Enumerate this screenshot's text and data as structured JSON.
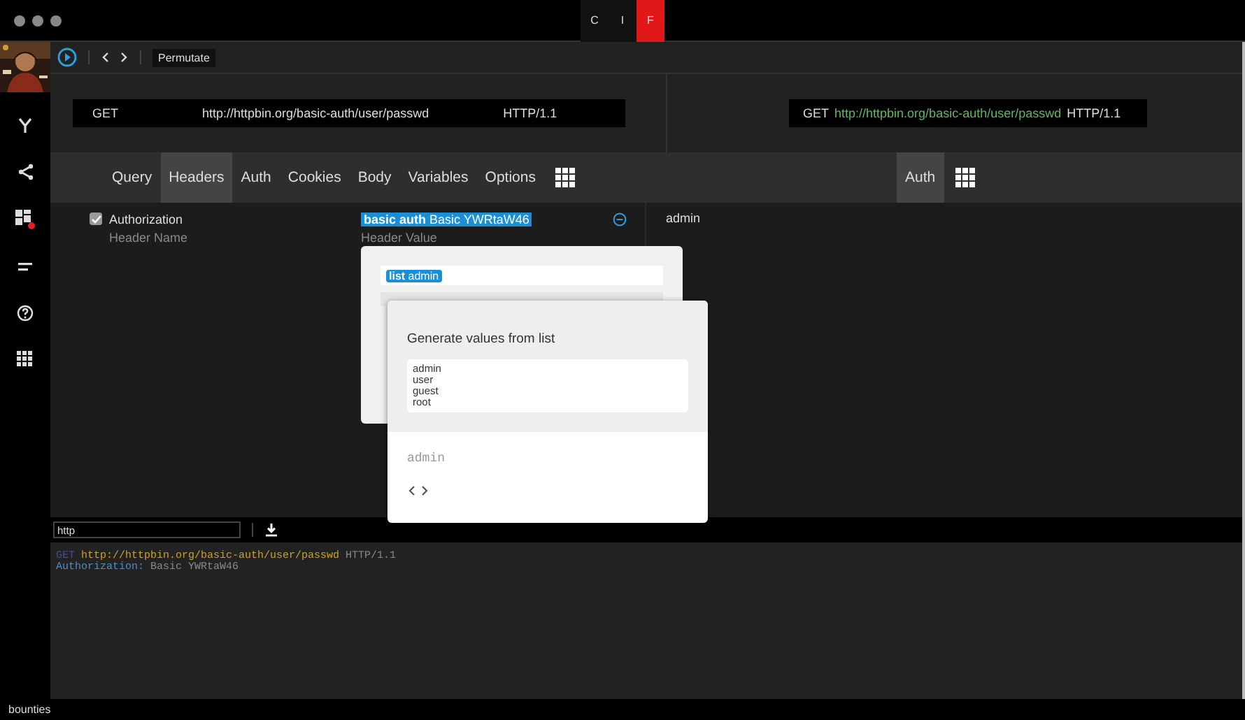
{
  "window": {
    "tabs": [
      {
        "label": "C",
        "selected": false
      },
      {
        "label": "I",
        "selected": false
      },
      {
        "label": "F",
        "selected": true
      }
    ]
  },
  "toolbar": {
    "mode_select": "Permutate"
  },
  "request": {
    "method": "GET",
    "url": "http://httpbin.org/basic-auth/user/passwd",
    "protocol": "HTTP/1.1"
  },
  "preview_request": {
    "method": "GET",
    "url": "http://httpbin.org/basic-auth/user/passwd",
    "protocol": "HTTP/1.1"
  },
  "tabs": [
    {
      "label": "Query",
      "selected": false
    },
    {
      "label": "Headers",
      "selected": true
    },
    {
      "label": "Auth",
      "selected": false
    },
    {
      "label": "Cookies",
      "selected": false
    },
    {
      "label": "Body",
      "selected": false
    },
    {
      "label": "Variables",
      "selected": false
    },
    {
      "label": "Options",
      "selected": false
    }
  ],
  "preview_tabs": [
    {
      "label": "Auth",
      "selected": true
    }
  ],
  "headers": [
    {
      "enabled": true,
      "name": "Authorization",
      "value": "**basic auth** Basic YWRtaW46",
      "preview": "admin"
    }
  ],
  "new_header": {
    "name_placeholder": "Header Name",
    "value_placeholder": "Header Value"
  },
  "token_popup": {
    "token": "**list** admin"
  },
  "list_popup": {
    "title": "Generate values from list",
    "values": "admin\nuser\nguest\nroot",
    "preview": "admin"
  },
  "output": {
    "format": "http",
    "lines": [
      [
        {
          "kind": "method",
          "text": "GET"
        },
        {
          "kind": "url",
          "text": "http://httpbin.org/basic-auth/user/passwd"
        },
        {
          "kind": "plain",
          "text": "HTTP/1.1"
        }
      ],
      [
        {
          "kind": "key",
          "text": "Authorization:"
        },
        {
          "kind": "plain",
          "text": "Basic YWRtaW46"
        }
      ]
    ]
  },
  "status_bar": "bounties"
}
